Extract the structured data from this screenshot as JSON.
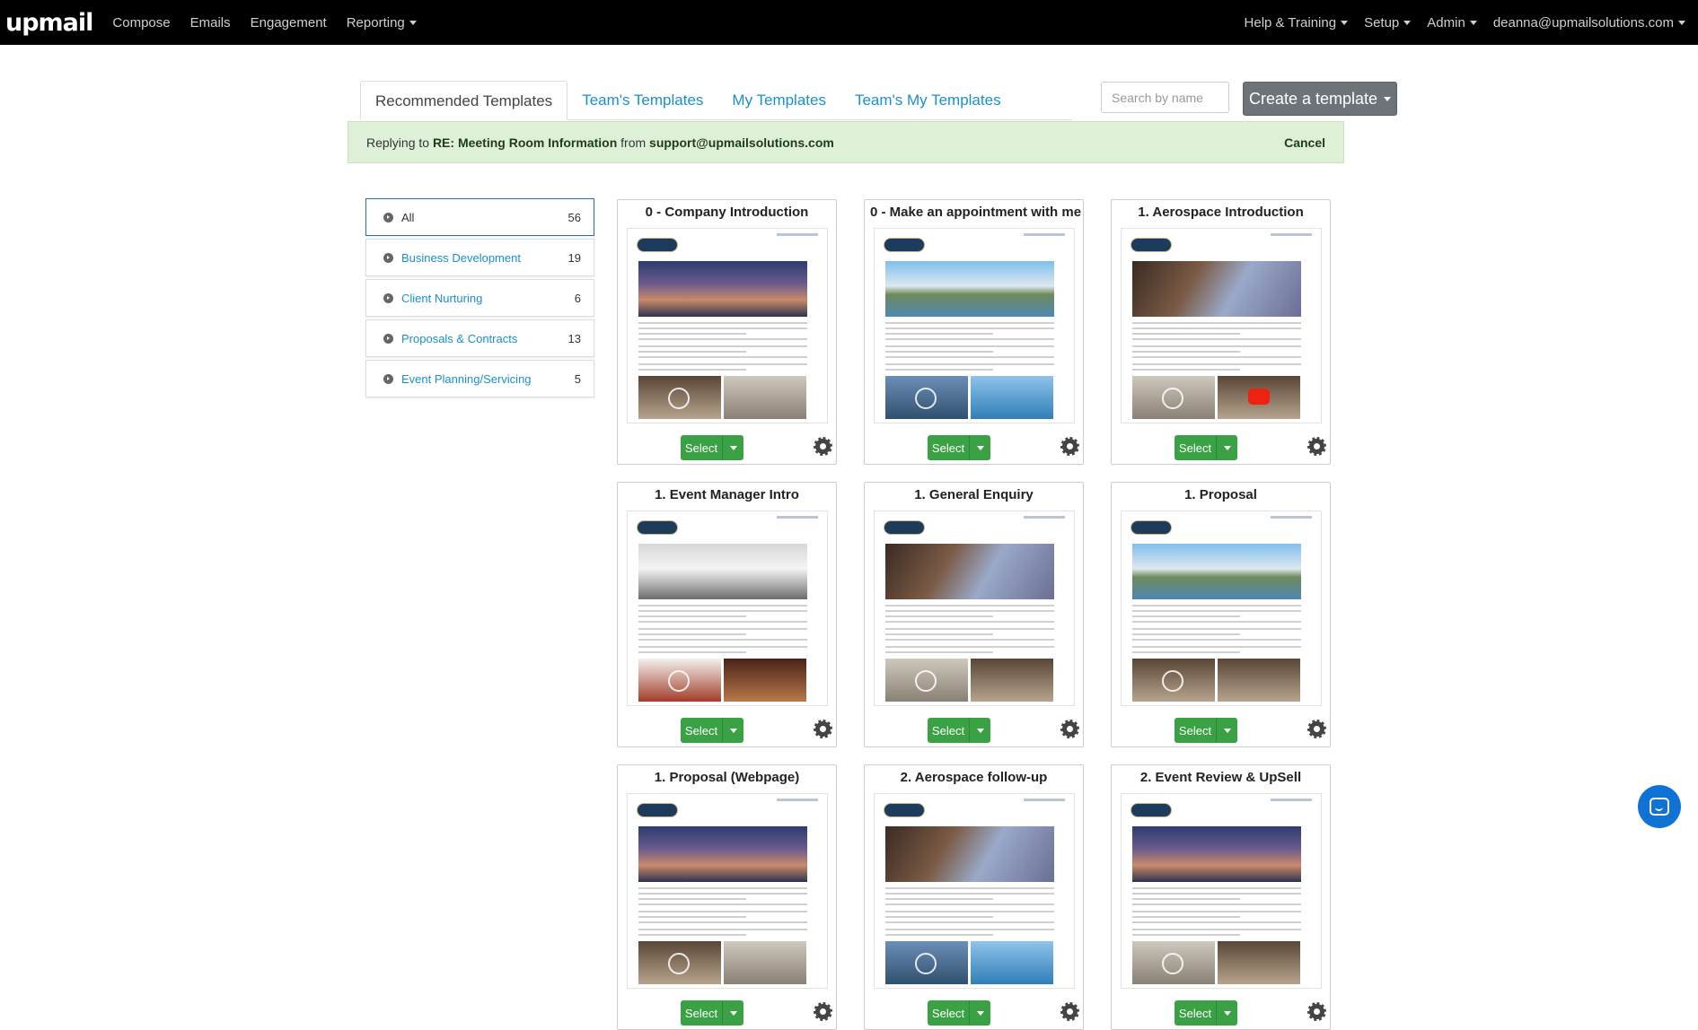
{
  "navbar": {
    "brand": "upmail",
    "left": [
      "Compose",
      "Emails",
      "Engagement",
      "Reporting"
    ],
    "right": [
      "Help & Training",
      "Setup",
      "Admin",
      "deanna@upmailsolutions.com"
    ]
  },
  "tabs": [
    "Recommended Templates",
    "Team's Templates",
    "My Templates",
    "Team's My Templates"
  ],
  "search": {
    "placeholder": "Search by name"
  },
  "create_button": "Create a template",
  "banner": {
    "prefix": "Replying to",
    "subject": "RE: Meeting Room Information",
    "from_label": "from",
    "email": "support@upmailsolutions.com",
    "cancel": "Cancel"
  },
  "categories": [
    {
      "label": "All",
      "count": "56"
    },
    {
      "label": "Business Development",
      "count": "19"
    },
    {
      "label": "Client Nurturing",
      "count": "6"
    },
    {
      "label": "Proposals & Contracts",
      "count": "13"
    },
    {
      "label": "Event Planning/Servicing",
      "count": "5"
    }
  ],
  "cards": [
    {
      "title": "0 - Company Introduction",
      "select": "Select"
    },
    {
      "title": "0 - Make an appointment with me",
      "select": "Select"
    },
    {
      "title": "1. Aerospace Introduction",
      "select": "Select"
    },
    {
      "title": "1. Event Manager Intro",
      "select": "Select"
    },
    {
      "title": "1. General Enquiry",
      "select": "Select"
    },
    {
      "title": "1. Proposal",
      "select": "Select"
    },
    {
      "title": "1. Proposal (Webpage)",
      "select": "Select"
    },
    {
      "title": "2. Aerospace follow-up",
      "select": "Select"
    },
    {
      "title": "2. Event Review & UpSell",
      "select": "Select"
    }
  ],
  "colors": {
    "navbar": "#000000",
    "link": "#1a8fd0",
    "select": "#3aa245",
    "banner": "#dff0d8",
    "chat": "#0f73d6"
  }
}
